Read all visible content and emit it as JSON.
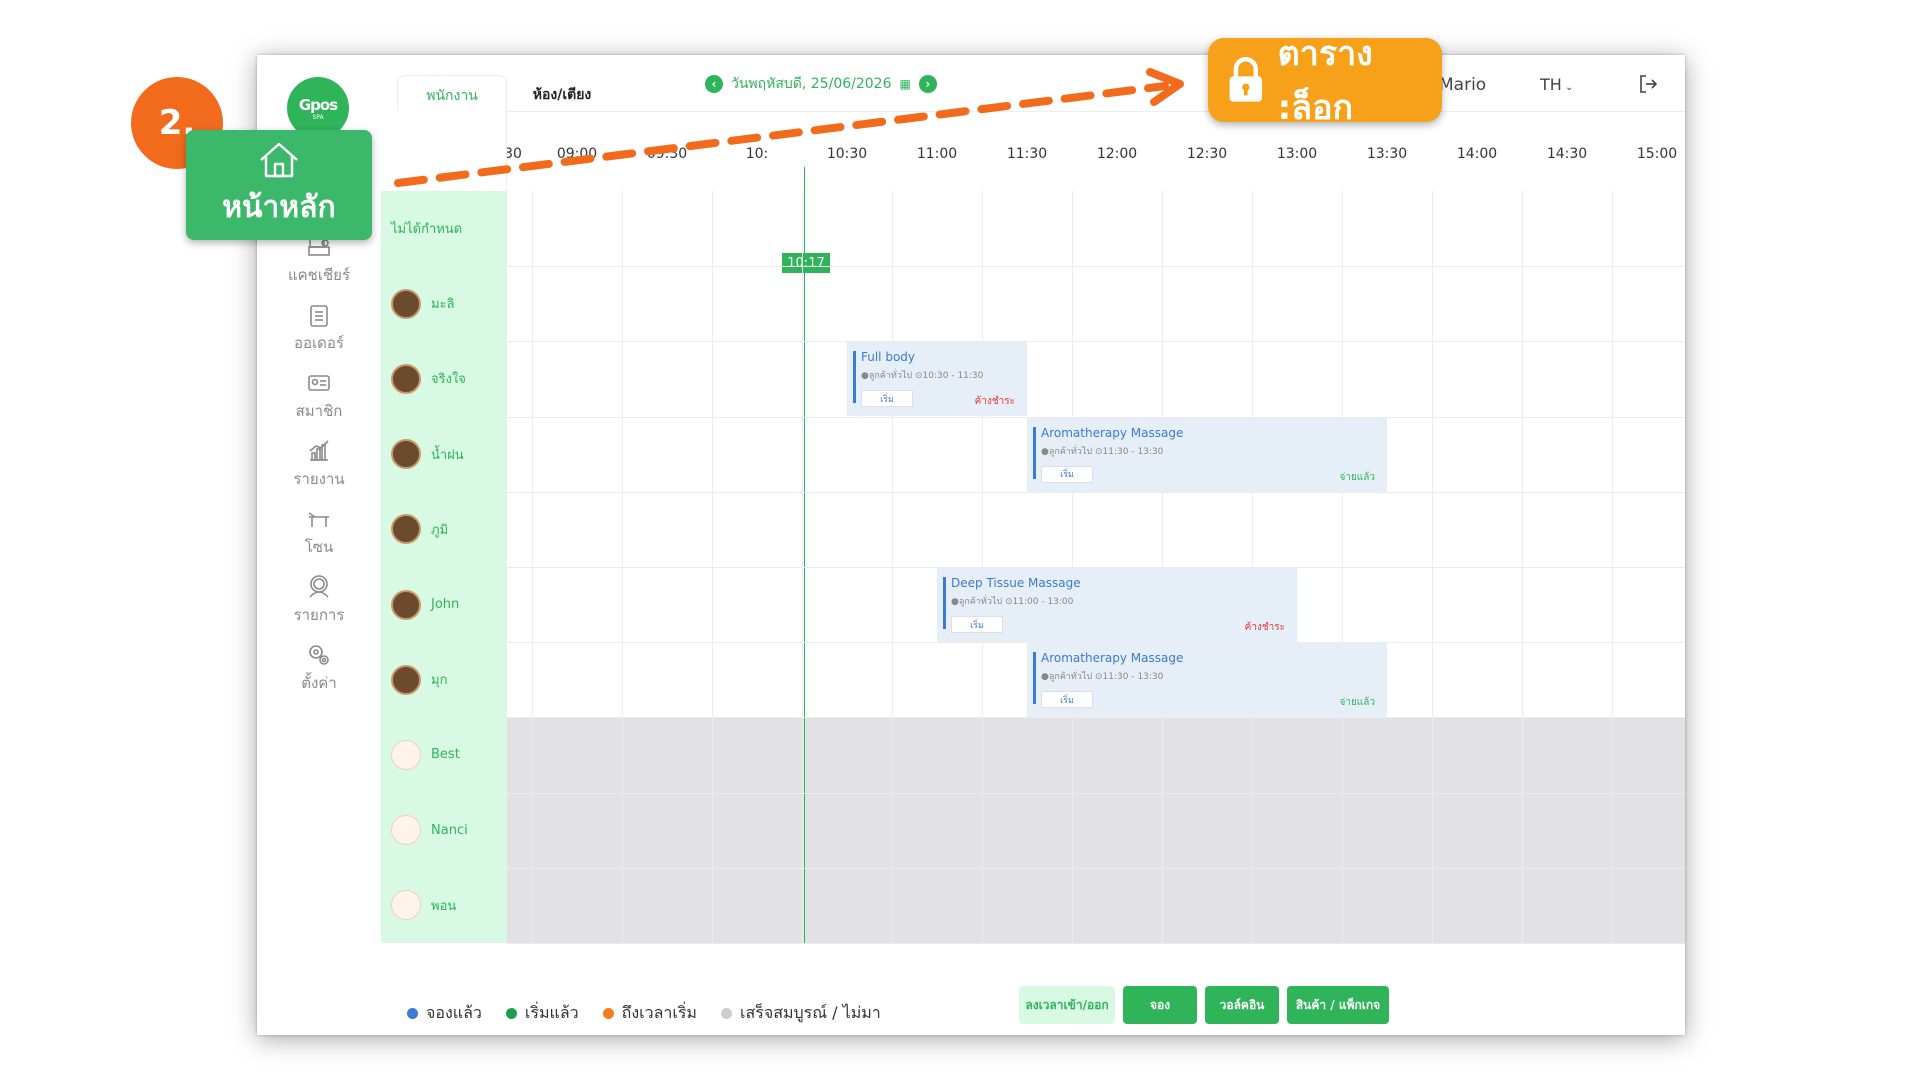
{
  "tutorial": {
    "step": "2.",
    "home_label": "หน้าหลัก",
    "lock_label": "ตาราง :ล็อก",
    "colors": {
      "step": "#f26b1d",
      "home_card": "#3bb86a",
      "lock_badge": "#f7a11a",
      "arrow": "#f26b1d"
    }
  },
  "header": {
    "logo_text": "Gpos",
    "logo_sub": "SPA",
    "tabs": [
      "พนักงาน",
      "ห้อง/เตียง"
    ],
    "date": "วันพฤหัสบดี, 25/06/2026",
    "user": "Mario",
    "lang": "TH"
  },
  "sidebar": {
    "items": [
      {
        "label": "แคชเชียร์",
        "icon": "cashier-icon"
      },
      {
        "label": "ออเดอร์",
        "icon": "clipboard-icon"
      },
      {
        "label": "สมาชิก",
        "icon": "member-card-icon"
      },
      {
        "label": "รายงาน",
        "icon": "chart-icon"
      },
      {
        "label": "โซน",
        "icon": "bed-icon"
      },
      {
        "label": "รายการ",
        "icon": "service-icon"
      },
      {
        "label": "ตั้งค่า",
        "icon": "settings-icon"
      }
    ]
  },
  "timeline": {
    "ticks": [
      "30",
      "09:00",
      "09:30",
      "10:",
      "10:30",
      "11:00",
      "11:30",
      "12:00",
      "12:30",
      "13:00",
      "13:30",
      "14:00",
      "14:30",
      "15:00"
    ],
    "current_time": "10:17"
  },
  "staff": [
    {
      "name": "ไม่ได้กำหนด",
      "avatar": "none"
    },
    {
      "name": "มะลิ",
      "avatar": "photo"
    },
    {
      "name": "จริงใจ",
      "avatar": "photo"
    },
    {
      "name": "น้ำฝน",
      "avatar": "photo"
    },
    {
      "name": "ภูมิ",
      "avatar": "photo"
    },
    {
      "name": "John",
      "avatar": "photo"
    },
    {
      "name": "มุก",
      "avatar": "photo"
    },
    {
      "name": "Best",
      "avatar": "placeholder"
    },
    {
      "name": "Nanci",
      "avatar": "placeholder"
    },
    {
      "name": "พอน",
      "avatar": "placeholder"
    }
  ],
  "bookings": [
    {
      "title": "Full body",
      "customer": "●ลูกค้าทั่วไป",
      "time": "⊙10:30 - 11:30",
      "start_label": "เริ่ม",
      "status": "ค้างชำระ",
      "status_type": "unpaid",
      "staff_index": 2,
      "start": "10:30",
      "end": "11:30"
    },
    {
      "title": "Aromatherapy Massage",
      "customer": "●ลูกค้าทั่วไป",
      "time": "⊙11:30 - 13:30",
      "start_label": "เริ่ม",
      "status": "จ่ายแล้ว",
      "status_type": "paid",
      "staff_index": 3,
      "start": "11:30",
      "end": "13:30"
    },
    {
      "title": "Deep Tissue Massage",
      "customer": "●ลูกค้าทั่วไป",
      "time": "⊙11:00 - 13:00",
      "start_label": "เริ่ม",
      "status": "ค้างชำระ",
      "status_type": "unpaid",
      "staff_index": 5,
      "start": "11:00",
      "end": "13:00"
    },
    {
      "title": "Aromatherapy Massage",
      "customer": "●ลูกค้าทั่วไป",
      "time": "⊙11:30 - 13:30",
      "start_label": "เริ่ม",
      "status": "จ่ายแล้ว",
      "status_type": "paid",
      "staff_index": 6,
      "start": "11:30",
      "end": "13:30"
    }
  ],
  "legend": [
    {
      "label": "จองแล้ว",
      "color": "#3a7bd5"
    },
    {
      "label": "เริ่มแล้ว",
      "color": "#1e9e4a"
    },
    {
      "label": "ถึงเวลาเริ่ม",
      "color": "#f57c1f"
    },
    {
      "label": "เสร็จสมบูรณ์ / ไม่มา",
      "color": "#cccccc"
    }
  ],
  "footer_buttons": [
    "ลงเวลาเข้า/ออก",
    "จอง",
    "วอล์คอิน",
    "สินค้า / แพ็กเกจ"
  ]
}
